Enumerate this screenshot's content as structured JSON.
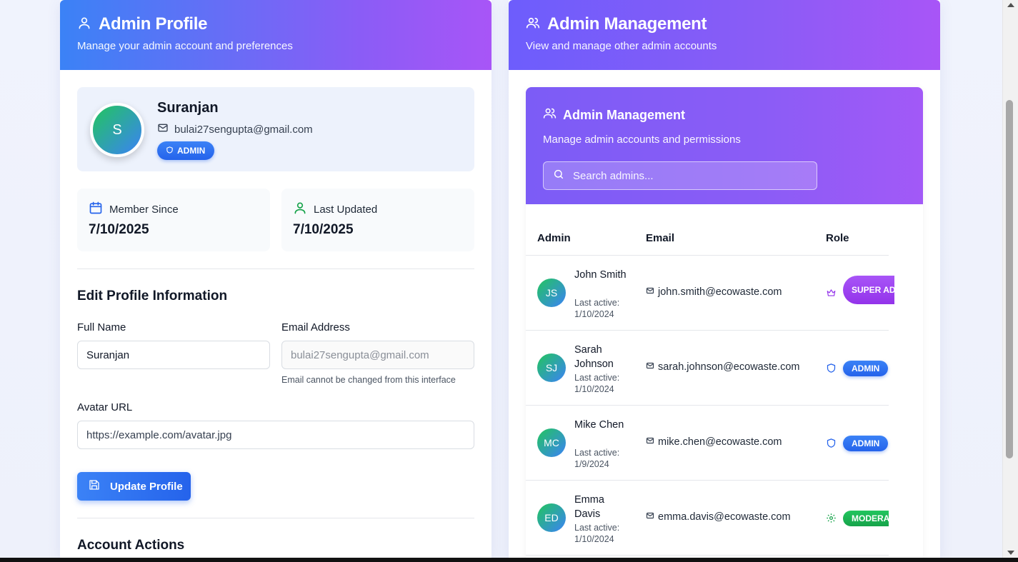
{
  "profile_panel": {
    "title": "Admin Profile",
    "subtitle": "Manage your admin account and preferences",
    "avatar_initial": "S",
    "name": "Suranjan",
    "email": "bulai27sengupta@gmail.com",
    "role": "ADMIN",
    "stats": [
      {
        "label": "Member Since",
        "value": "7/10/2025"
      },
      {
        "label": "Last Updated",
        "value": "7/10/2025"
      }
    ],
    "edit_title": "Edit Profile Information",
    "full_name_label": "Full Name",
    "full_name_value": "Suranjan",
    "email_label": "Email Address",
    "email_value": "bulai27sengupta@gmail.com",
    "email_hint": "Email cannot be changed from this interface",
    "avatar_label": "Avatar URL",
    "avatar_placeholder": "https://example.com/avatar.jpg",
    "update_button": "Update Profile",
    "account_actions_title": "Account Actions"
  },
  "management_panel": {
    "title": "Admin Management",
    "subtitle": "View and manage other admin accounts",
    "card_title": "Admin Management",
    "card_subtitle": "Manage admin accounts and permissions",
    "search_placeholder": "Search admins...",
    "columns": [
      "Admin",
      "Email",
      "Role"
    ],
    "rows": [
      {
        "initials": "JS",
        "name": "John Smith",
        "last_active": "Last active: 1/10/2024",
        "email": "john.smith@ecowaste.com",
        "role": "SUPER ADMIN",
        "role_icon": "crown-icon"
      },
      {
        "initials": "SJ",
        "name": "Sarah Johnson",
        "last_active": "Last active: 1/10/2024",
        "email": "sarah.johnson@ecowaste.com",
        "role": "ADMIN",
        "role_icon": "shield-icon"
      },
      {
        "initials": "MC",
        "name": "Mike Chen",
        "last_active": "Last active: 1/9/2024",
        "email": "mike.chen@ecowaste.com",
        "role": "ADMIN",
        "role_icon": "shield-icon"
      },
      {
        "initials": "ED",
        "name": "Emma Davis",
        "last_active": "Last active: 1/10/2024",
        "email": "emma.davis@ecowaste.com",
        "role": "MODERATOR",
        "role_icon": "gear-icon"
      }
    ]
  },
  "colors": {
    "header_gradient_start": "#3b82f6",
    "header_gradient_end": "#a855f7",
    "admin_badge": "#2563eb",
    "super_admin_badge": "#9333ea",
    "moderator_badge": "#16a34a"
  }
}
